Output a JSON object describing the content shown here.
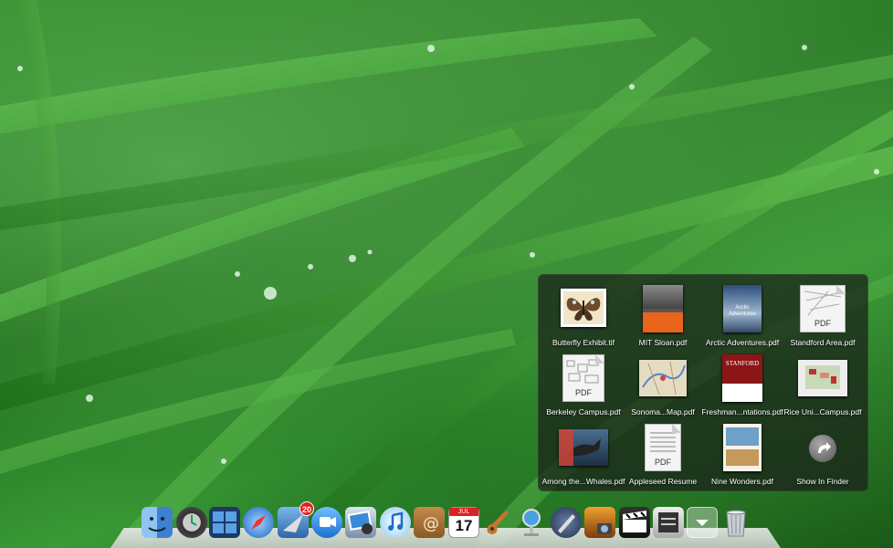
{
  "stack": {
    "items": [
      {
        "label": "Butterfly Exhibit.tif",
        "icon": "butterfly-image-icon"
      },
      {
        "label": "MIT Sloan.pdf",
        "icon": "pdf-document-icon"
      },
      {
        "label": "Arctic Adventures.pdf",
        "icon": "pdf-document-icon"
      },
      {
        "label": "Standford Area.pdf",
        "icon": "pdf-document-icon"
      },
      {
        "label": "Berkeley Campus.pdf",
        "icon": "pdf-document-icon"
      },
      {
        "label": "Sonoma...Map.pdf",
        "icon": "pdf-document-icon"
      },
      {
        "label": "Freshman...ntations.pdf",
        "icon": "pdf-document-icon"
      },
      {
        "label": "Rice Uni...Campus.pdf",
        "icon": "pdf-document-icon"
      },
      {
        "label": "Among the...Whales.pdf",
        "icon": "pdf-document-icon"
      },
      {
        "label": "Appleseed Resume",
        "icon": "pdf-document-icon"
      },
      {
        "label": "Nine Wonders.pdf",
        "icon": "pdf-document-icon"
      },
      {
        "label": "Show In Finder",
        "icon": "show-in-finder-icon"
      }
    ],
    "pdf_tag": "PDF",
    "arctic_title": "Arctic Adventures",
    "stanford_title": "STANFORD"
  },
  "dock": {
    "mail_badge": "20",
    "calendar_day": "17",
    "calendar_month": "JUL"
  }
}
